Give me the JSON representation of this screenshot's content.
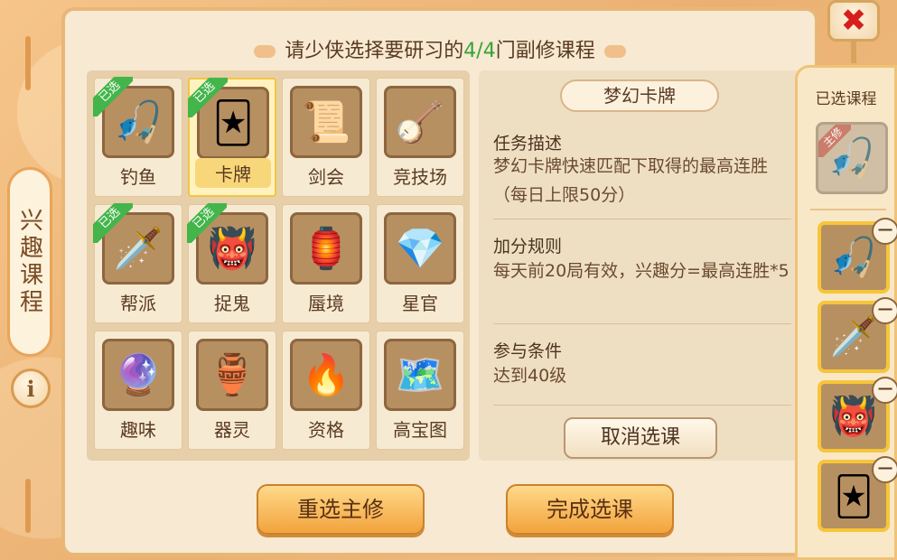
{
  "side_tab": {
    "label": "兴趣课程"
  },
  "info_icon": "i",
  "close_icon": "✖",
  "title": {
    "prefix": "请少侠选择要研习的",
    "count": "4/4",
    "suffix": "门副修课程"
  },
  "courses": [
    {
      "label": "钓鱼",
      "icon": "🎣",
      "badge": "已选",
      "selected": false
    },
    {
      "label": "卡牌",
      "icon": "🃏",
      "badge": "已选",
      "selected": true
    },
    {
      "label": "剑会",
      "icon": "📜",
      "badge": "",
      "selected": false
    },
    {
      "label": "竞技场",
      "icon": "🪕",
      "badge": "",
      "selected": false
    },
    {
      "label": "帮派",
      "icon": "🗡️",
      "badge": "已选",
      "selected": false
    },
    {
      "label": "捉鬼",
      "icon": "👹",
      "badge": "已选",
      "selected": false
    },
    {
      "label": "蜃境",
      "icon": "🏮",
      "badge": "",
      "selected": false
    },
    {
      "label": "星官",
      "icon": "💎",
      "badge": "",
      "selected": false
    },
    {
      "label": "趣味",
      "icon": "🔮",
      "badge": "",
      "selected": false
    },
    {
      "label": "器灵",
      "icon": "🏺",
      "badge": "",
      "selected": false
    },
    {
      "label": "资格",
      "icon": "🔥",
      "badge": "",
      "selected": false
    },
    {
      "label": "高宝图",
      "icon": "🗺️",
      "badge": "",
      "selected": false
    }
  ],
  "detail": {
    "title": "梦幻卡牌",
    "desc_head": "任务描述",
    "desc_body": "梦幻卡牌快速匹配下取得的最高连胜（每日上限50分）",
    "rule_head": "加分规则",
    "rule_body": "每天前20局有效，兴趣分=最高连胜*5",
    "cond_head": "参与条件",
    "cond_body": "达到40级",
    "cancel_label": "取消选课"
  },
  "buttons": {
    "reselect": "重选主修",
    "finish": "完成选课"
  },
  "right_panel": {
    "header": "已选课程",
    "main_badge": "主修",
    "main_icon": "🎣",
    "selected": [
      {
        "icon": "🎣"
      },
      {
        "icon": "🗡️"
      },
      {
        "icon": "👹"
      },
      {
        "icon": "🃏"
      }
    ],
    "remove_icon": "−"
  }
}
